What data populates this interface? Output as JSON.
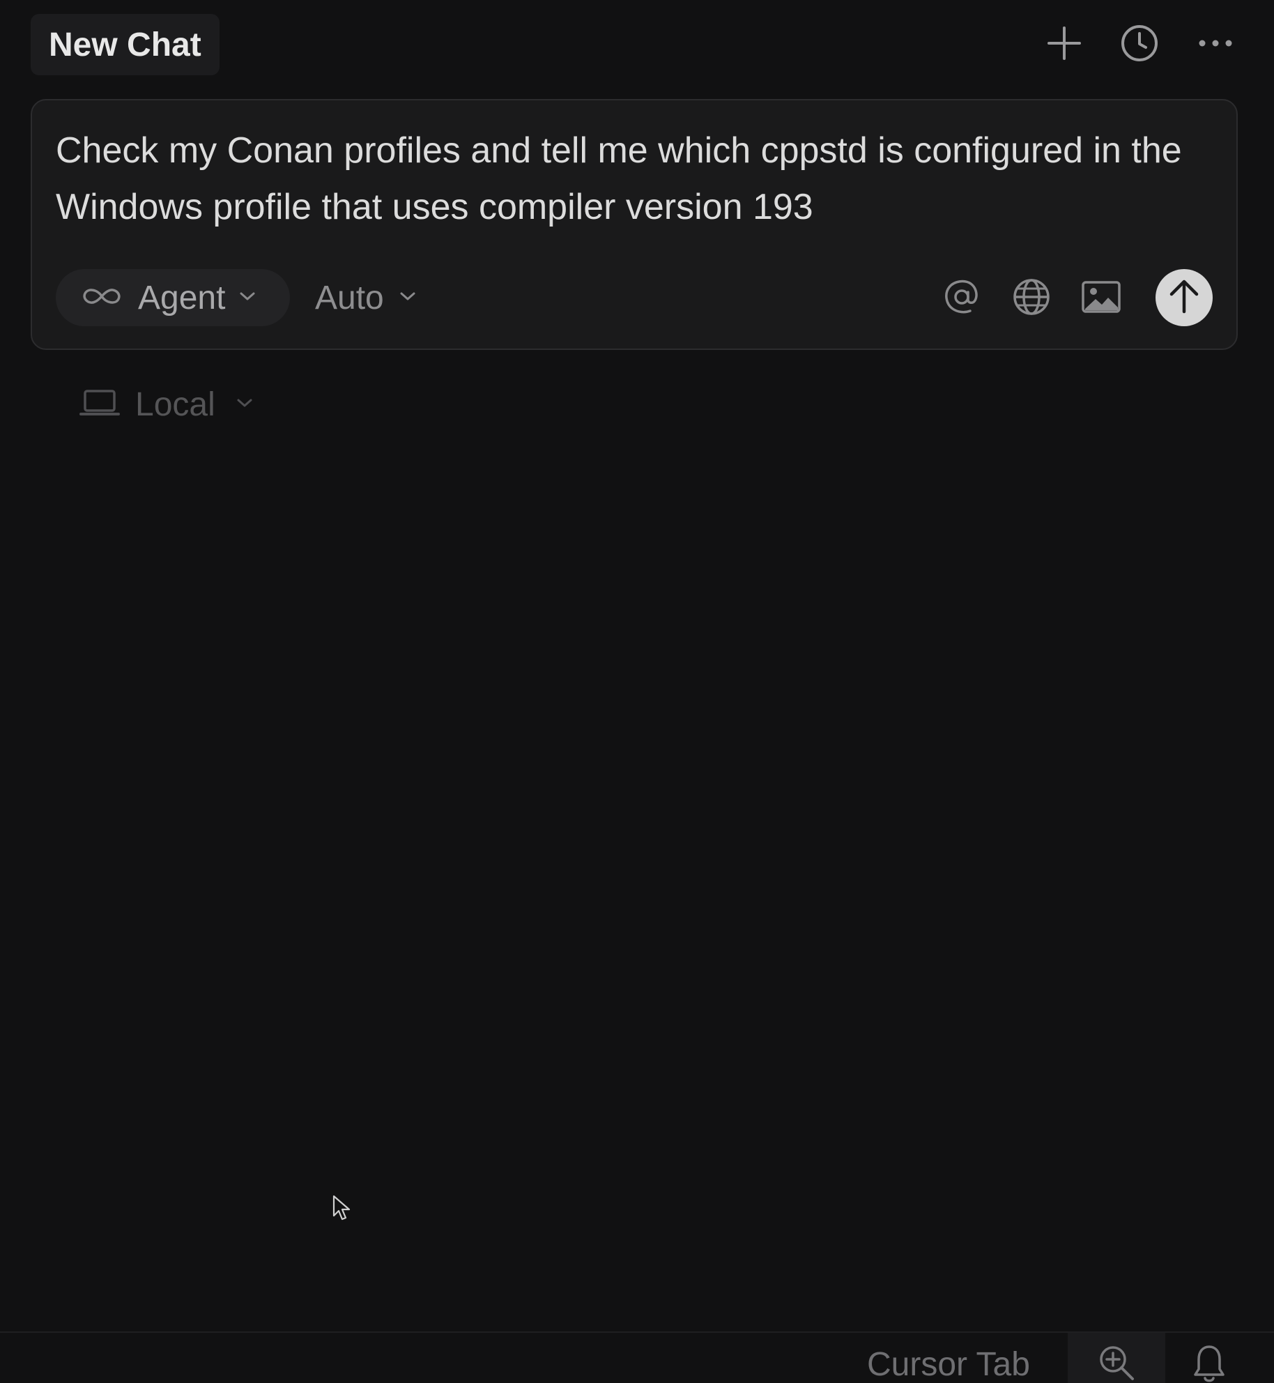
{
  "header": {
    "tab_title": "New Chat",
    "icons": [
      "plus-icon",
      "history-clock-icon",
      "more-horizontal-icon"
    ]
  },
  "composer": {
    "prompt_text": "Check my Conan profiles and tell me which cppstd is configured in the Windows profile that uses compiler version 193",
    "mode_label": "Agent",
    "mode_icon": "infinity-icon",
    "model_label": "Auto",
    "icons": [
      "at-mention-icon",
      "globe-icon",
      "image-icon",
      "send-arrow-up-icon"
    ]
  },
  "environment": {
    "label": "Local",
    "icon": "laptop-icon"
  },
  "status_bar": {
    "label": "Cursor Tab",
    "icons": [
      "zoom-in-icon",
      "bell-icon"
    ]
  },
  "colors": {
    "background": "#111112",
    "composer_bg": "#1a1a1b",
    "send_button": "#d6d6d6"
  }
}
